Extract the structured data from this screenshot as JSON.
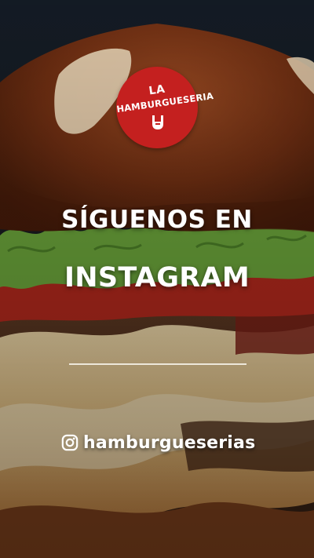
{
  "logo": {
    "line1": "LA",
    "line2": "HAMBURGUESERIA",
    "color": "#c4201f",
    "mark_icon": "rock-hand-icon"
  },
  "headline": {
    "line1": "SÍGUENOS EN",
    "line2": "INSTAGRAM"
  },
  "instagram": {
    "icon": "instagram-icon",
    "handle": "hamburgueserias"
  },
  "colors": {
    "text": "#ffffff",
    "brand_red": "#c4201f",
    "divider": "#f4efe6"
  }
}
